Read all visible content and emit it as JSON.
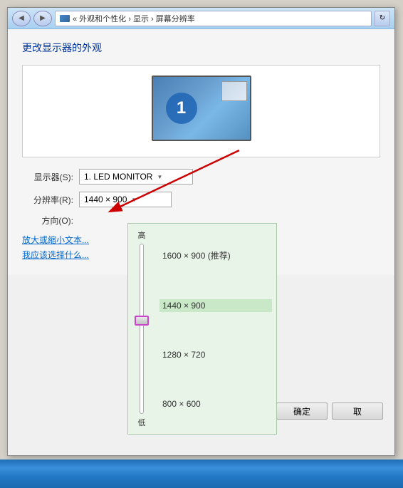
{
  "window": {
    "title": "屏幕分辨率",
    "address_bar": "« 外观和个性化 › 显示 › 屏幕分辨率"
  },
  "page": {
    "title": "更改显示器的外观"
  },
  "monitor_preview": {
    "number": "1"
  },
  "form": {
    "display_label": "显示器(S):",
    "display_value": "1. LED MONITOR",
    "resolution_label": "分辨率(R):",
    "resolution_value": "1440 × 900",
    "orientation_label": "方向(O):"
  },
  "resolution_popup": {
    "high_label": "高",
    "low_label": "低",
    "options": [
      {
        "label": "1600 × 900 (推荐)",
        "recommended": true,
        "selected": false
      },
      {
        "label": "1440 × 900",
        "recommended": false,
        "selected": true
      },
      {
        "label": "1280 × 720",
        "recommended": false,
        "selected": false
      },
      {
        "label": "800 × 600",
        "recommended": false,
        "selected": false
      }
    ]
  },
  "links": [
    {
      "text": "放大或缩小文本..."
    },
    {
      "text": "我应该选择什么..."
    }
  ],
  "buttons": {
    "confirm": "确定",
    "cancel": "取"
  }
}
